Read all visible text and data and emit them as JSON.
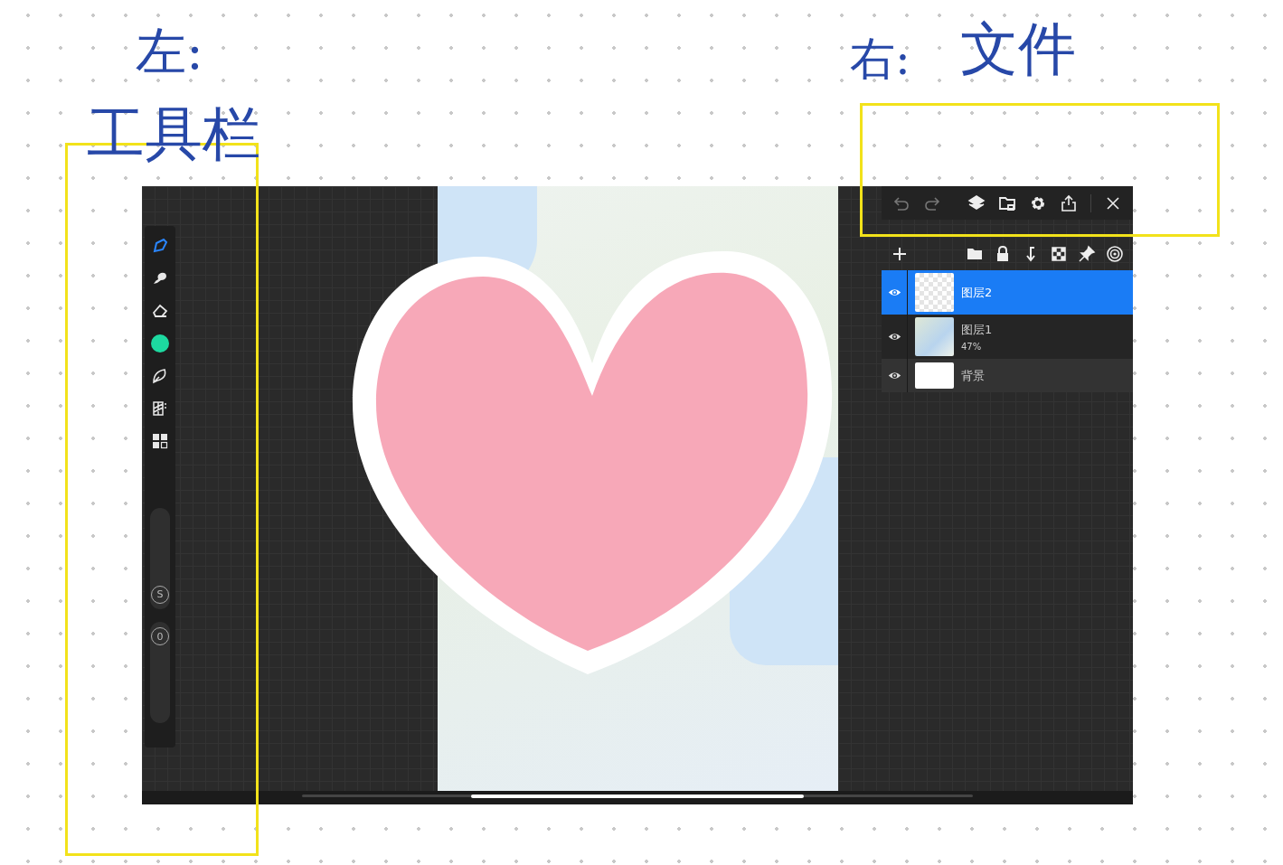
{
  "annotations": [
    {
      "text": "左:",
      "kind": "left"
    },
    {
      "text": "工具栏",
      "kind": "left-sub"
    },
    {
      "text": "右:",
      "kind": "right"
    },
    {
      "text": "文件",
      "kind": "right-sub"
    }
  ],
  "app": {
    "tools": [
      {
        "kind": "brush",
        "selected": true
      },
      {
        "kind": "smudge",
        "selected": false
      },
      {
        "kind": "eraser",
        "selected": false
      },
      {
        "kind": "color",
        "selected": false,
        "color": "#1dd9a0"
      },
      {
        "kind": "lasso",
        "selected": false
      },
      {
        "kind": "adjust",
        "selected": false
      },
      {
        "kind": "gallery",
        "selected": false
      }
    ],
    "sliders": [
      {
        "label": "S",
        "level": 0.05
      },
      {
        "label": "0",
        "level": 0.95
      }
    ],
    "layers": [
      {
        "name": "图层2",
        "selected": true,
        "visible": true,
        "kind": "sketch"
      },
      {
        "name": "图层1",
        "opacity": "47%",
        "selected": false,
        "visible": true,
        "kind": "map"
      },
      {
        "name": "背景",
        "selected": false,
        "visible": true,
        "kind": "blank"
      }
    ]
  }
}
